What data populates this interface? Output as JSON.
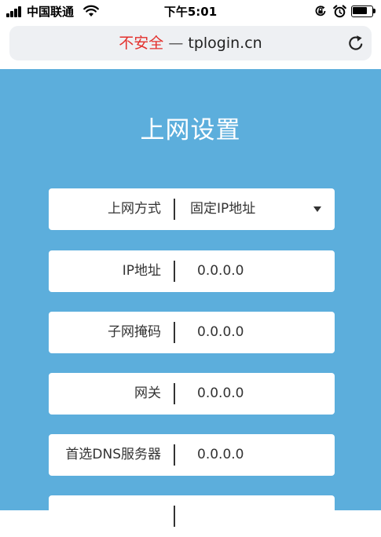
{
  "status_bar": {
    "carrier": "中国联通",
    "time": "下午5:01",
    "battery_level": 0.8
  },
  "browser": {
    "insecure_label": "不安全",
    "separator": "—",
    "domain": "tplogin.cn"
  },
  "page": {
    "title": "上网设置",
    "fields": [
      {
        "label": "上网方式",
        "value": "固定IP地址",
        "type": "select"
      },
      {
        "label": "IP地址",
        "value": "0.0.0.0",
        "type": "text"
      },
      {
        "label": "子网掩码",
        "value": "0.0.0.0",
        "type": "text"
      },
      {
        "label": "网关",
        "value": "0.0.0.0",
        "type": "text"
      },
      {
        "label": "首选DNS服务器",
        "value": "0.0.0.0",
        "type": "text"
      }
    ]
  },
  "icons": {
    "signal": "signal-bars-icon",
    "wifi": "wifi-icon",
    "rotation_lock": "rotation-lock-icon",
    "alarm": "alarm-clock-icon",
    "battery": "battery-icon",
    "reload": "reload-icon",
    "dropdown": "chevron-down-icon"
  },
  "colors": {
    "page_background": "#5caedc",
    "insecure_text": "#e3302c",
    "field_background": "#ffffff"
  }
}
